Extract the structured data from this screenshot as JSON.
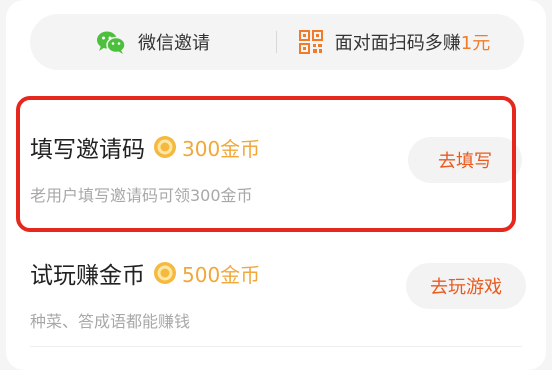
{
  "invite_bar": {
    "wechat_label": "微信邀请",
    "wechat_icon": "wechat-icon",
    "qr_label": "面对面扫码多赚",
    "qr_accent": "1元",
    "qr_icon": "qr-code-icon"
  },
  "tasks": [
    {
      "title": "填写邀请码",
      "reward": "300金币",
      "description": "老用户填写邀请码可领300金币",
      "button": "去填写",
      "highlighted": true
    },
    {
      "title": "试玩赚金币",
      "reward": "500金币",
      "description": "种菜、答成语都能赚钱",
      "button": "去玩游戏",
      "highlighted": false
    }
  ],
  "colors": {
    "accent": "#ea5a1e",
    "coin": "#f0a83a",
    "highlight": "#e6271d",
    "wechat": "#4cbf3c"
  }
}
